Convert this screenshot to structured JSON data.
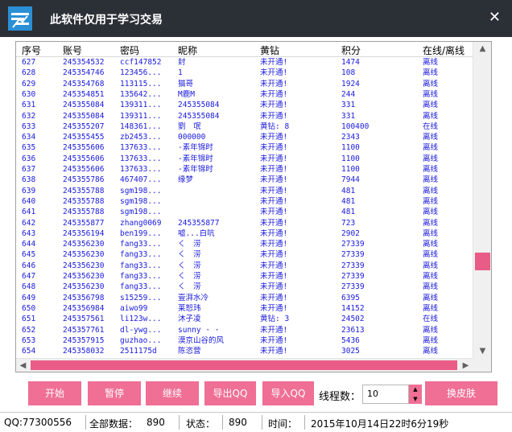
{
  "window": {
    "title": "此软件仅用于学习交易",
    "close_label": "✕",
    "icon": "app-logo-icon",
    "accent": "#ef6f95",
    "titlebar_color": "#2b2f36"
  },
  "table": {
    "columns": [
      "序号",
      "账号",
      "密码",
      "昵称",
      "黄钻",
      "积分",
      "在线/离线"
    ],
    "rows": [
      [
        "627",
        "245354532",
        "ccf147852",
        "封",
        "未开通!",
        "1474",
        "离线"
      ],
      [
        "628",
        "245354746",
        "123456...",
        "1",
        "未开通!",
        "108",
        "离线"
      ],
      [
        "629",
        "245354768",
        "113115...",
        "猫哥",
        "未开通!",
        "1924",
        "离线"
      ],
      [
        "630",
        "245354851",
        "135642...",
        "M鹿M",
        "未开通!",
        "244",
        "离线"
      ],
      [
        "631",
        "245355084",
        "139311...",
        "245355084",
        "未开通!",
        "331",
        "离线"
      ],
      [
        "632",
        "245355084",
        "139311...",
        "245355084",
        "未开通!",
        "331",
        "离线"
      ],
      [
        "633",
        "245355207",
        "148361...",
        "劉　氓",
        "黄钻: 8",
        "100400",
        "在线"
      ],
      [
        "634",
        "245355455",
        "zb2453...",
        "000000",
        "未开通!",
        "2343",
        "离线"
      ],
      [
        "635",
        "245355606",
        "137633...",
        " -素年锦时",
        "未开通!",
        "1100",
        "离线"
      ],
      [
        "636",
        "245355606",
        "137633...",
        " -素年锦时",
        "未开通!",
        "1100",
        "离线"
      ],
      [
        "637",
        "245355606",
        "137633...",
        " -素年锦时",
        "未开通!",
        "1100",
        "离线"
      ],
      [
        "638",
        "245355786",
        "467407...",
        "缘梦",
        "未开通!",
        "7944",
        "离线"
      ],
      [
        "639",
        "245355788",
        "sgm198...",
        "",
        "未开通!",
        "481",
        "离线"
      ],
      [
        "640",
        "245355788",
        "sgm198...",
        "",
        "未开通!",
        "481",
        "离线"
      ],
      [
        "641",
        "245355788",
        "sgm198...",
        "",
        "未开通!",
        "481",
        "离线"
      ],
      [
        "642",
        "245355877",
        "zhang0069",
        "245355877",
        "未开通!",
        "723",
        "离线"
      ],
      [
        "643",
        "245356194",
        "ben199...",
        "嘘...白吭",
        "未开通!",
        "2902",
        "离线"
      ],
      [
        "644",
        "245356230",
        "fang33...",
        "く　涝",
        "未开通!",
        "27339",
        "离线"
      ],
      [
        "645",
        "245356230",
        "fang33...",
        "く　涝",
        "未开通!",
        "27339",
        "离线"
      ],
      [
        "646",
        "245356230",
        "fang33...",
        "く　涝",
        "未开通!",
        "27339",
        "离线"
      ],
      [
        "647",
        "245356230",
        "fang33...",
        "く　涝",
        "未开通!",
        "27339",
        "离线"
      ],
      [
        "648",
        "245356230",
        "fang33...",
        "く　涝",
        "未开通!",
        "27339",
        "离线"
      ],
      [
        "649",
        "245356798",
        "s15259...",
        "壹湃水冷",
        "未开通!",
        "6395",
        "离线"
      ],
      [
        "650",
        "245356984",
        "aiwo99",
        "莱恕玮",
        "未开通!",
        "14152",
        "离线"
      ],
      [
        "651",
        "245357561",
        "li123w...",
        "沐子凌",
        "黄钻: 3",
        "24502",
        "在线"
      ],
      [
        "652",
        "245357761",
        "dl-ywg...",
        "sunny · ·",
        "未开通!",
        "23613",
        "离线"
      ],
      [
        "653",
        "245357915",
        "guzhao...",
        "漠京山谷的风",
        "未开通!",
        "5436",
        "离线"
      ],
      [
        "654",
        "245358032",
        "2511175d",
        "陈恣营",
        "未开通!",
        "3025",
        "离线"
      ]
    ]
  },
  "scroll": {
    "up_icon": "▲",
    "down_icon": "▼",
    "left_icon": "◀",
    "right_icon": "▶",
    "vertical_position": 0.74
  },
  "buttons": {
    "start": "开始",
    "pause": "暂停",
    "resume": "继续",
    "export_qq": "导出QQ",
    "import_qq": "导入QQ",
    "skin": "换皮肤"
  },
  "threads": {
    "label": "线程数：",
    "value": "10",
    "up_icon": "▲",
    "down_icon": "▼"
  },
  "status": {
    "qq": "QQ:77300556",
    "total_label": "全部数据：",
    "total_value": "890",
    "state_label": "状态：",
    "state_value": "890",
    "time_label": "时间：",
    "time_value": "2015年10月14日22时6分19秒"
  }
}
